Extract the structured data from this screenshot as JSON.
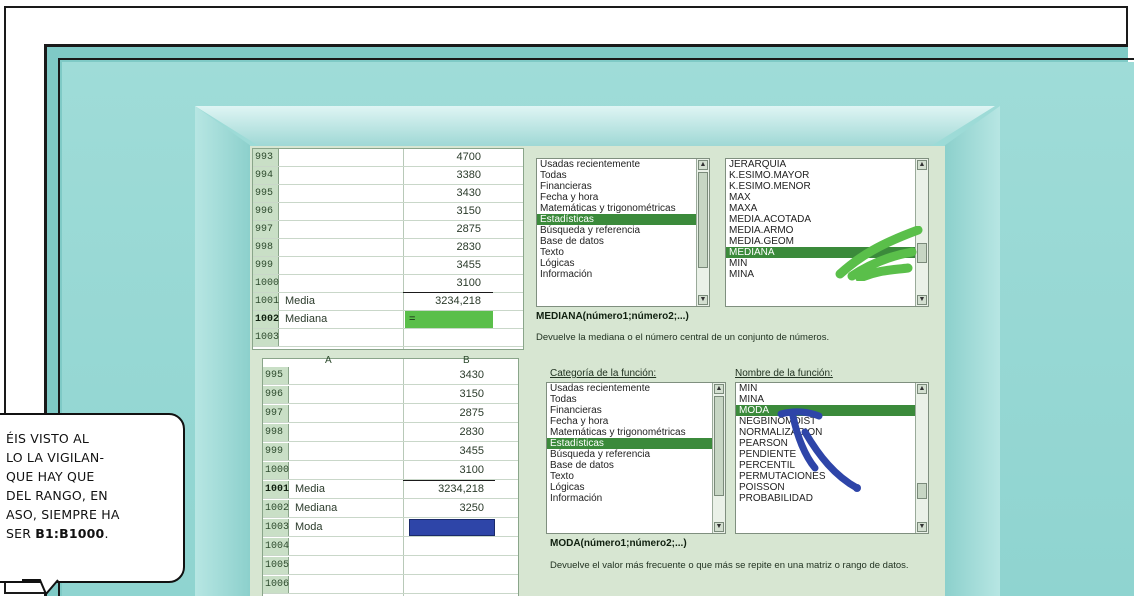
{
  "top_sheet": {
    "rows": [
      {
        "num": "993",
        "label": "",
        "value": "4700"
      },
      {
        "num": "994",
        "label": "",
        "value": "3380"
      },
      {
        "num": "995",
        "label": "",
        "value": "3430"
      },
      {
        "num": "996",
        "label": "",
        "value": "3150"
      },
      {
        "num": "997",
        "label": "",
        "value": "2875"
      },
      {
        "num": "998",
        "label": "",
        "value": "2830"
      },
      {
        "num": "999",
        "label": "",
        "value": "3455"
      },
      {
        "num": "1000",
        "label": "",
        "value": "3100"
      },
      {
        "num": "1001",
        "label": "Media",
        "value": "3234,218"
      },
      {
        "num": "1002",
        "label": "Mediana",
        "value": "="
      },
      {
        "num": "1003",
        "label": "",
        "value": ""
      }
    ]
  },
  "bottom_sheet": {
    "col_a": "A",
    "col_b": "B",
    "rows": [
      {
        "num": "995",
        "label": "",
        "value": "3430"
      },
      {
        "num": "996",
        "label": "",
        "value": "3150"
      },
      {
        "num": "997",
        "label": "",
        "value": "2875"
      },
      {
        "num": "998",
        "label": "",
        "value": "2830"
      },
      {
        "num": "999",
        "label": "",
        "value": "3455"
      },
      {
        "num": "1000",
        "label": "",
        "value": "3100"
      },
      {
        "num": "1001",
        "label": "Media",
        "value": "3234,218"
      },
      {
        "num": "1002",
        "label": "Mediana",
        "value": "3250"
      },
      {
        "num": "1003",
        "label": "Moda",
        "value": ""
      },
      {
        "num": "1004",
        "label": "",
        "value": ""
      },
      {
        "num": "1005",
        "label": "",
        "value": ""
      },
      {
        "num": "1006",
        "label": "",
        "value": ""
      }
    ]
  },
  "top_panel": {
    "categories": [
      "Usadas recientemente",
      "Todas",
      "Financieras",
      "Fecha y hora",
      "Matemáticas y trigonométricas",
      "Estadísticas",
      "Búsqueda y referencia",
      "Base de datos",
      "Texto",
      "Lógicas",
      "Información"
    ],
    "selected_category": 5,
    "functions": [
      "JERARQUIA",
      "K.ESIMO.MAYOR",
      "K.ESIMO.MENOR",
      "MAX",
      "MAXA",
      "MEDIA.ACOTADA",
      "MEDIA.ARMO",
      "MEDIA.GEOM",
      "MEDIANA",
      "MIN",
      "MINA"
    ],
    "selected_function": 8,
    "syntax": "MEDIANA(número1;número2;...)",
    "description": "Devuelve la mediana o el número central de un conjunto de números."
  },
  "bottom_panel": {
    "category_label": "Categoría de la función:",
    "function_label": "Nombre de la función:",
    "categories": [
      "Usadas recientemente",
      "Todas",
      "Financieras",
      "Fecha y hora",
      "Matemáticas y trigonométricas",
      "Estadísticas",
      "Búsqueda y referencia",
      "Base de datos",
      "Texto",
      "Lógicas",
      "Información"
    ],
    "selected_category": 5,
    "functions": [
      "MIN",
      "MINA",
      "MODA",
      "NEGBINOMDIST",
      "NORMALIZACION",
      "PEARSON",
      "PENDIENTE",
      "PERCENTIL",
      "PERMUTACIONES",
      "POISSON",
      "PROBABILIDAD"
    ],
    "selected_function": 2,
    "syntax": "MODA(número1;número2;...)",
    "description": "Devuelve el valor más frecuente o que más se repite en una matriz o rango de datos."
  },
  "bubble": {
    "lines": [
      "ÉIS VISTO AL",
      "LO LA VIGILAN-",
      "QUE HAY QUE",
      " DEL RANGO, EN",
      "ASO, SIEMPRE HA",
      "SER "
    ],
    "range_bold": "B1:B1000",
    "end": "."
  },
  "colors": {
    "wall": "#8fd4d0",
    "screen": "#d7e6d2",
    "selection": "#3b8a3b",
    "mark_green": "#5abf4a",
    "mark_blue": "#2e45a8"
  }
}
